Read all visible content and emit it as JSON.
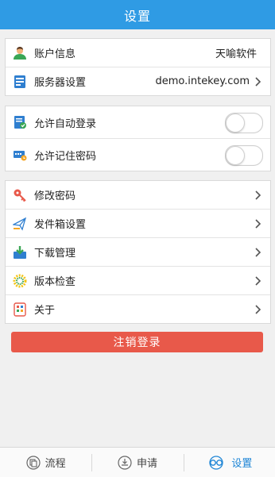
{
  "header": {
    "title": "设置"
  },
  "account": {
    "items": [
      {
        "label": "账户信息",
        "value": "天喻软件"
      },
      {
        "label": "服务器设置",
        "value": "demo.intekey.com"
      }
    ]
  },
  "toggles": {
    "items": [
      {
        "label": "允许自动登录",
        "on": false
      },
      {
        "label": "允许记住密码",
        "on": false
      }
    ]
  },
  "menu": {
    "items": [
      {
        "label": "修改密码"
      },
      {
        "label": "发件箱设置"
      },
      {
        "label": "下载管理"
      },
      {
        "label": "版本检查"
      },
      {
        "label": "关于"
      }
    ]
  },
  "logout_label": "注销登录",
  "tabs": [
    {
      "label": "流程",
      "icon": "flow-icon",
      "active": false
    },
    {
      "label": "申请",
      "icon": "apply-icon",
      "active": false
    },
    {
      "label": "设置",
      "icon": "settings-icon",
      "active": true
    }
  ],
  "colors": {
    "header": "#2f9be4",
    "logout": "#e8594a",
    "active_tab": "#1f86d6"
  }
}
